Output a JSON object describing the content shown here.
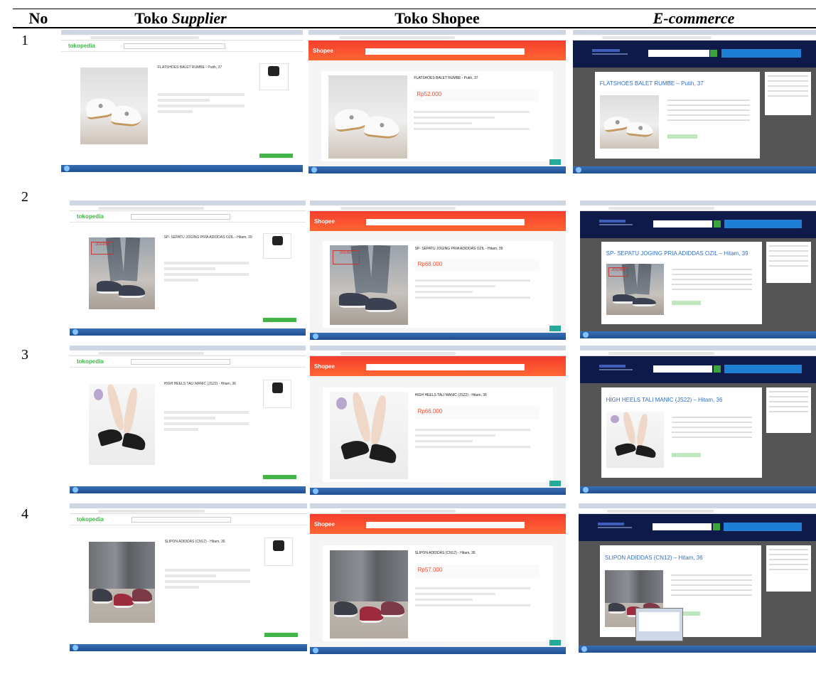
{
  "table": {
    "headers": {
      "no": "No",
      "supplier_prefix": "Toko ",
      "supplier_italic": "Supplier",
      "shopee": "Toko Shopee",
      "ecommerce": "E-commerce"
    },
    "rows": [
      {
        "no": "1",
        "product": "FLATSHOES BALET RUMBE - Putih, 37",
        "shopee_price": "Rp52.000",
        "ecom_title": "FLATSHOES BALET RUMBE – Putih, 37"
      },
      {
        "no": "2",
        "product": "SP- SEPATU JOGING PRIA ADIDDAS OZIL - Hitam, 39",
        "shopee_price": "Rp68.000",
        "ecom_title": "SP- SEPATU JOGING PRIA ADIDDAS OZIL – Hitam, 39"
      },
      {
        "no": "3",
        "product": "HIGH HEELS TALI MANIC (JS22) - Hitam, 36",
        "shopee_price": "Rp66.000",
        "ecom_title": "HIGH HEELS TALI MANIC (JS22) – Hitam, 36"
      },
      {
        "no": "4",
        "product": "SLIPON ADIDDAS (CN12) - Hitam, 36",
        "shopee_price": "Rp57.000",
        "ecom_title": "SLIPON ADIDDAS (CN12) – Hitam, 36"
      }
    ]
  },
  "thumbs": {
    "tokopedia_logo": "tokopedia",
    "shopee_logo": "Shopee",
    "jog_tag": "JOGING"
  },
  "colors": {
    "tokopedia_green": "#42b549",
    "shopee_orange": "#ee4d2d",
    "ecom_navy": "#0d1a4a",
    "ecom_title_blue": "#2f6fc9"
  }
}
